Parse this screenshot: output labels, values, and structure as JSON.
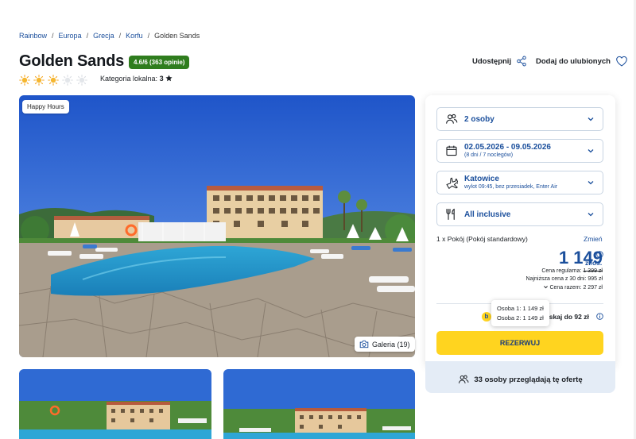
{
  "breadcrumb": {
    "items": [
      "Rainbow",
      "Europa",
      "Grecja",
      "Korfu"
    ],
    "current": "Golden Sands",
    "separator": "/"
  },
  "hotel": {
    "name": "Golden Sands",
    "rating_badge": "4.6/6 (363 opinie)",
    "suns_filled": 3,
    "suns_total": 5,
    "category_label": "Kategoria lokalna:",
    "category_value": "3"
  },
  "actions": {
    "share_label": "Udostępnij",
    "favorite_label": "Dodaj do ulubionych"
  },
  "gallery": {
    "badge": "Happy Hours",
    "button_label": "Galeria (19)"
  },
  "booking": {
    "persons": "2 osoby",
    "dates": "02.05.2026 - 09.05.2026",
    "dates_sub": "(8 dni / 7 noclegów)",
    "departure": "Katowice",
    "departure_sub": "wylot 09:45, bez przesiadek, Enter Air",
    "board": "All inclusive",
    "room": "1 x Pokój  (Pokój standardowy)",
    "change_label": "Zmień",
    "price": "1 149",
    "price_unit": "zł/os.",
    "regular_label": "Cena regularna:",
    "regular_value": "1 399 zł",
    "lowest_label": "Najniższa cena z 30 dni: 995 zł",
    "total_label": "Cena razem: 2 297 zł",
    "tooltip_line1": "Osoba 1: 1 149 zł",
    "tooltip_line2": "Osoba 2: 1 149 zł",
    "bonus_text": "yskaj do 92 zł",
    "reserve_label": "REZERWUJ",
    "viewers": "33 osoby przeglądają tę ofertę"
  },
  "colors": {
    "brand_blue": "#1b4f9c",
    "rating_green": "#2f7d1e",
    "cta_yellow": "#ffd41f",
    "panel_footer": "#e4ecf6"
  }
}
